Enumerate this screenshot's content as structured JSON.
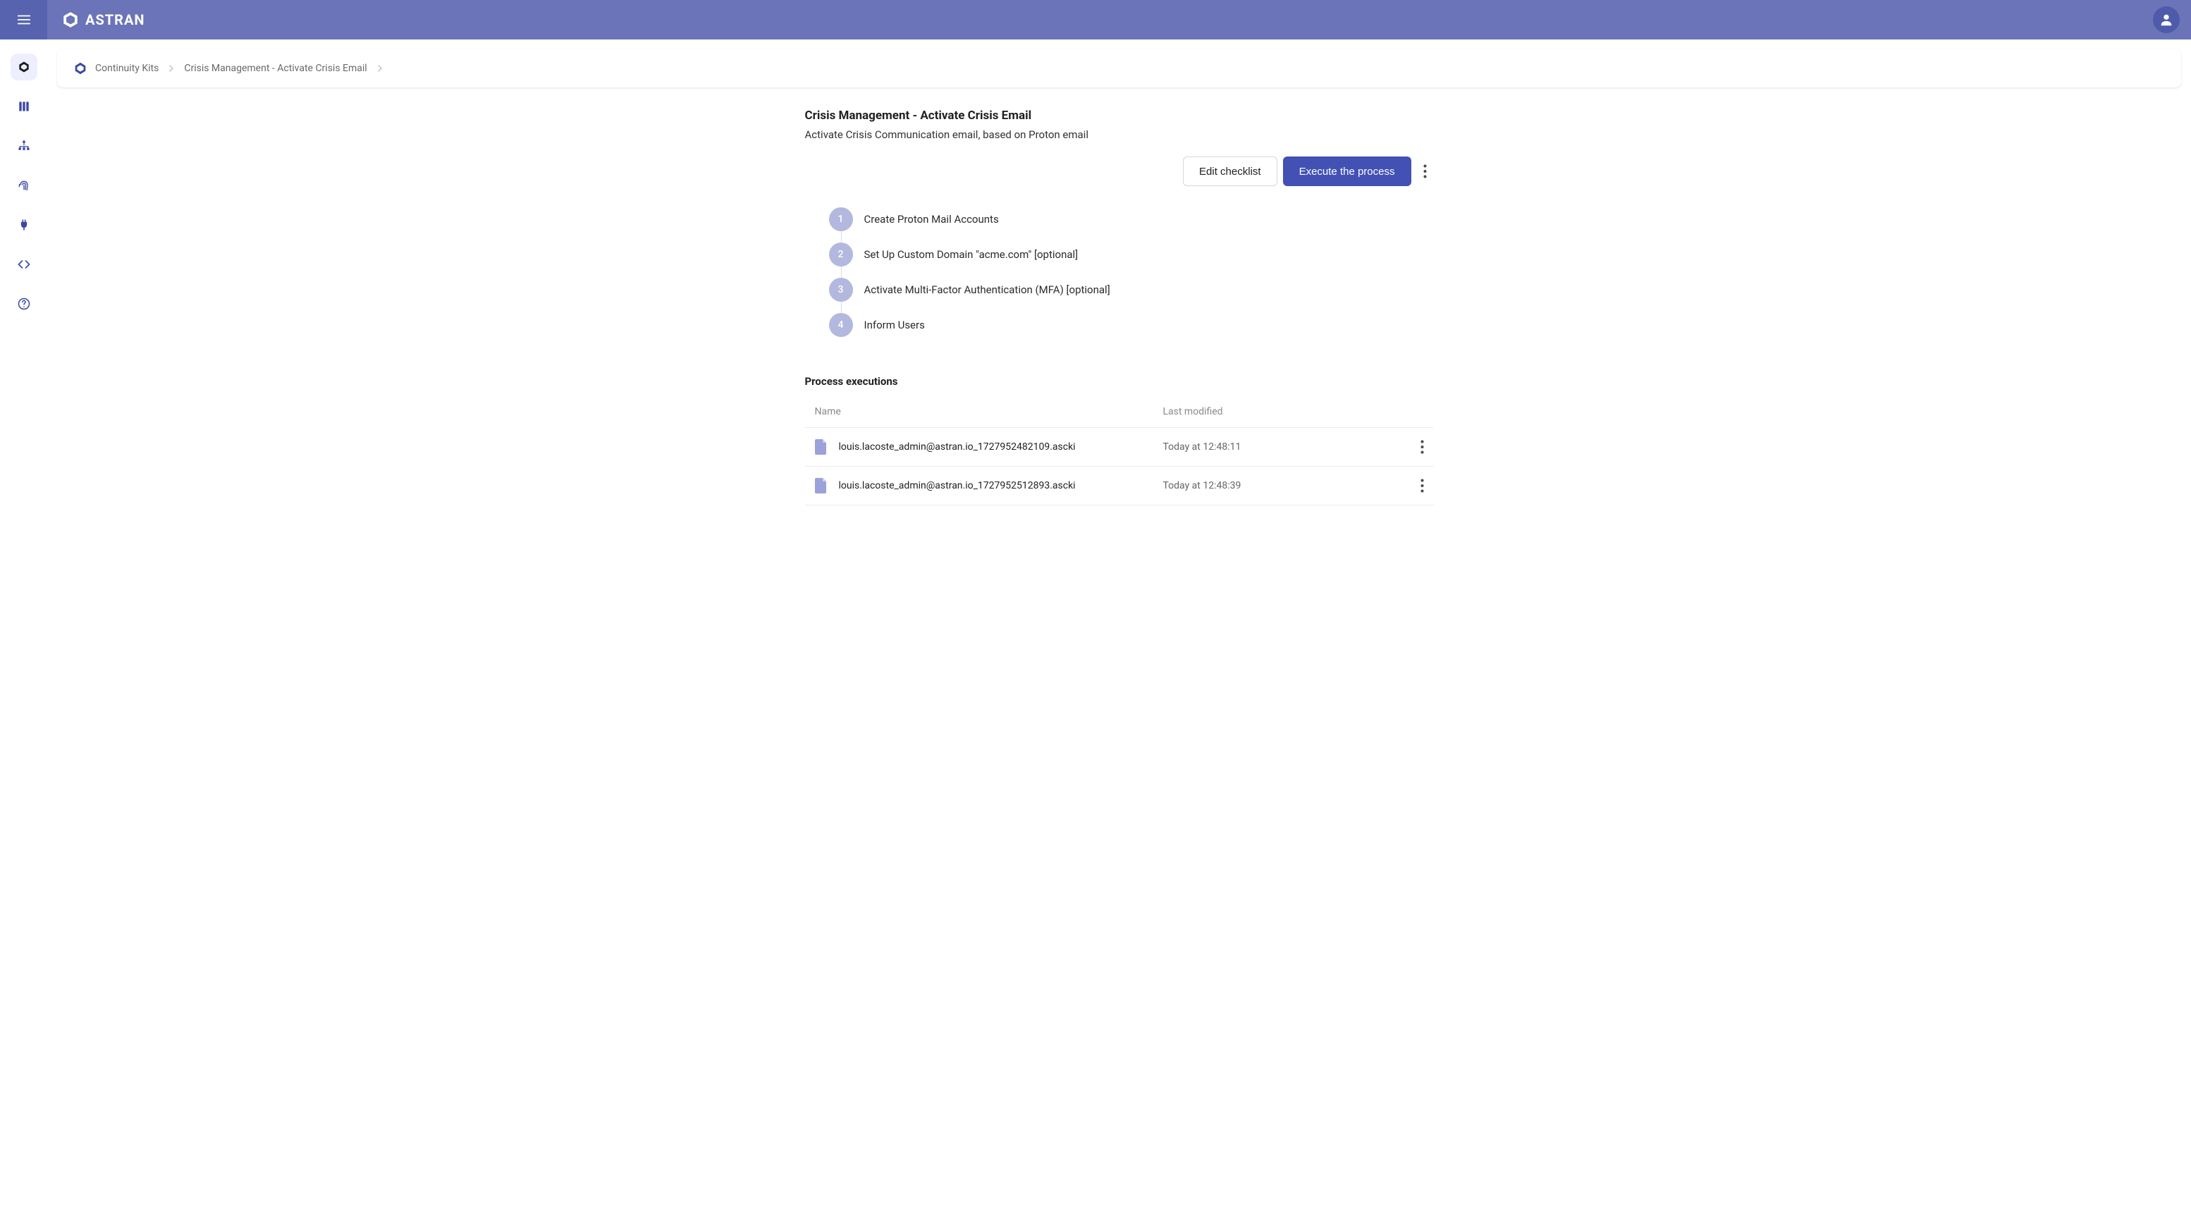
{
  "brand": "ASTRAN",
  "colors": {
    "accent": "#4351B5",
    "header": "#6B74B8",
    "hamburger": "#5863B0",
    "step": "#B3B8DE"
  },
  "breadcrumb": {
    "items": [
      {
        "label": "Continuity Kits"
      },
      {
        "label": "Crisis Management - Activate Crisis Email"
      }
    ]
  },
  "page": {
    "title": "Crisis Management - Activate Crisis Email",
    "subtitle": "Activate Crisis Communication email, based on Proton email"
  },
  "actions": {
    "edit": "Edit checklist",
    "execute": "Execute the process"
  },
  "steps": [
    {
      "num": "1",
      "label": "Create Proton Mail Accounts"
    },
    {
      "num": "2",
      "label": "Set Up Custom Domain \"acme.com\" [optional]"
    },
    {
      "num": "3",
      "label": "Activate Multi-Factor Authentication (MFA) [optional]"
    },
    {
      "num": "4",
      "label": "Inform Users"
    }
  ],
  "executions": {
    "title": "Process executions",
    "columns": {
      "name": "Name",
      "modified": "Last modified"
    },
    "rows": [
      {
        "name": "louis.lacoste_admin@astran.io_1727952482109.ascki",
        "modified": "Today at 12:48:11"
      },
      {
        "name": "louis.lacoste_admin@astran.io_1727952512893.ascki",
        "modified": "Today at 12:48:39"
      }
    ]
  }
}
